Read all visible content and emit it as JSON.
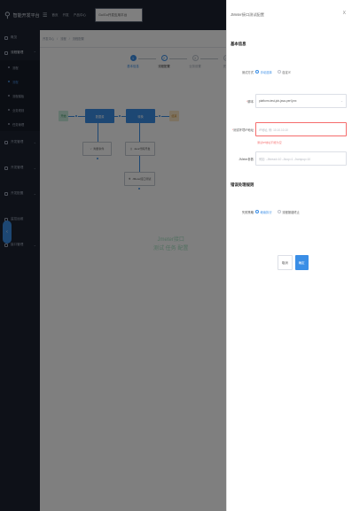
{
  "app": {
    "name": "智能开发平台"
  },
  "sidebar": {
    "items": [
      {
        "label": "概览"
      },
      {
        "label": "流程管理",
        "expanded": true,
        "children": [
          "流程",
          "流程",
          "流程模板",
          "业务规则",
          "任务管理"
        ]
      },
      {
        "label": "开发管理"
      },
      {
        "label": "开发管理"
      },
      {
        "label": "开发配置"
      },
      {
        "label": "监控运维"
      },
      {
        "label": "接口管理"
      }
    ],
    "active_child_index": 1
  },
  "topbar": {
    "items": [
      "首页",
      "开发",
      "产品中心"
    ],
    "search_value": "Go/Go开发应用平台"
  },
  "breadcrumb": [
    "开发中心",
    "流程",
    "流程配置"
  ],
  "steps": [
    {
      "number": "1",
      "label": "基本信息",
      "state": "done"
    },
    {
      "number": "2",
      "label": "流程配置",
      "state": "current"
    },
    {
      "number": "3",
      "label": "业务设置",
      "state": "todo"
    },
    {
      "number": "4",
      "label": "完成",
      "state": "todo"
    }
  ],
  "flow": {
    "start_label": "开始",
    "end_label": "结束",
    "node1_label": "数据源",
    "node2_label": "转换",
    "box1_label": "判断条件",
    "box2_label": "Java代码开发",
    "box3_label": "JMeter接口测试"
  },
  "watermark": [
    "Jmeter接口",
    "测试 任务 配置"
  ],
  "bottom_buttons": [
    "上一步",
    "下一步",
    "保存"
  ],
  "drawer": {
    "title": "JMeter接口测试配置",
    "close_glyph": "X",
    "section1_title": "基本信息",
    "mode_label": "测试方式",
    "mode_options": [
      "手动选择",
      "自定义"
    ],
    "script_label": "脚本",
    "script_value": "platform-test-job-java-perf-jmx",
    "host_label": "测试环境IP地址",
    "host_placeholder": "IP地址, 例: 10.10.10.10",
    "host_error": "测试IP地址不能为空",
    "jmeter_label": "JMeter参数",
    "jmeter_placeholder": "例如: -Jthread=10 -Jloop=1 -Jrampup=10",
    "section2_title": "错误处理规则",
    "policy_label": "失败策略",
    "policy_options": [
      "继续执行",
      "流程报错终止"
    ],
    "cancel_label": "取消",
    "ok_label": "确定"
  },
  "colors": {
    "accent": "#3a8ee6",
    "error": "#f56c6c",
    "sidebar": "#1c2331"
  }
}
